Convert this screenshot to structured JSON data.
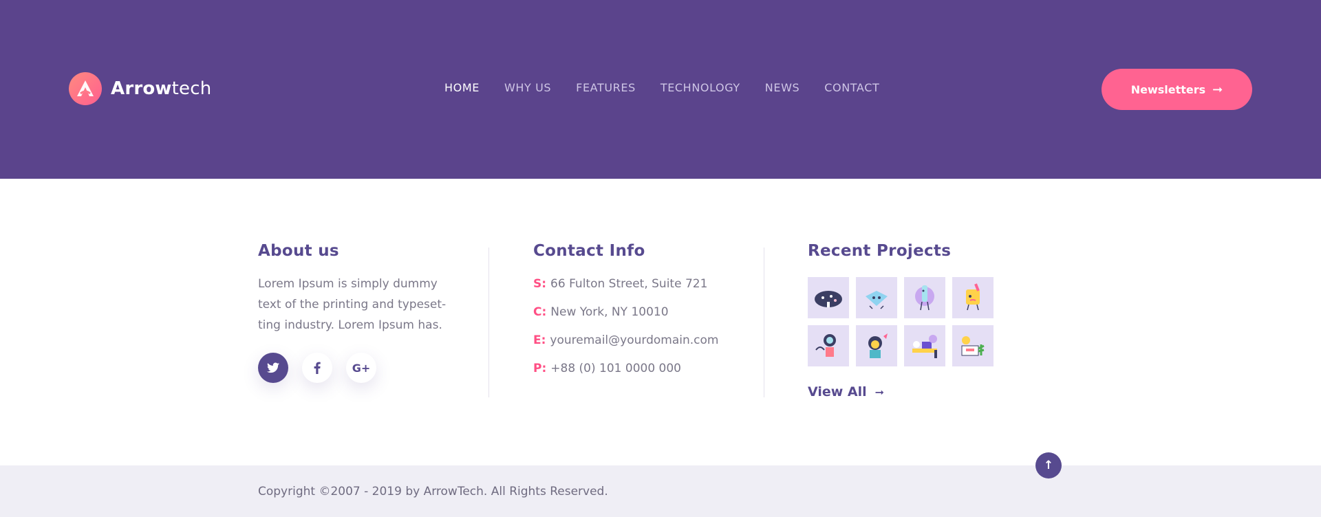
{
  "brand": {
    "name_bold": "Arrow",
    "name_light": "tech",
    "icon": "arrow-logo-icon"
  },
  "nav": {
    "items": [
      {
        "label": "HOME",
        "active": true
      },
      {
        "label": "WHY US"
      },
      {
        "label": "FEATURES"
      },
      {
        "label": "TECHNOLOGY"
      },
      {
        "label": "NEWS"
      },
      {
        "label": "CONTACT"
      }
    ]
  },
  "header": {
    "newsletter_label": "Newsletters",
    "arrow": "➞"
  },
  "about": {
    "title": "About us",
    "text": "Lorem Ipsum is simply dummy text of the printing and typeset-ting industry. Lorem Ipsum has.",
    "social": [
      {
        "icon": "twitter-icon"
      },
      {
        "icon": "facebook-icon"
      },
      {
        "icon": "google-plus-icon",
        "glyph": "G+"
      }
    ]
  },
  "contact": {
    "title": "Contact Info",
    "rows": [
      {
        "key": "S:",
        "value": "66 Fulton Street, Suite 721"
      },
      {
        "key": "C:",
        "value": "New York, NY 10010"
      },
      {
        "key": "E:",
        "value": "youremail@yourdomain.com"
      },
      {
        "key": "P:",
        "value": "+88 (0) 101 0000 000"
      }
    ]
  },
  "projects": {
    "title": "Recent Projects",
    "thumbnails": [
      "project-thumb-1",
      "project-thumb-2",
      "project-thumb-3",
      "project-thumb-4",
      "project-thumb-5",
      "project-thumb-6",
      "project-thumb-7",
      "project-thumb-8"
    ],
    "view_all": "View All",
    "arrow": "➞"
  },
  "footer": {
    "copyright": "Copyright ©2007 - 2019 by ArrowTech. All Rights Reserved."
  },
  "back_to_top": {
    "icon": "arrow-up-icon",
    "glyph": "↑"
  },
  "colors": {
    "header_bg": "#5b448c",
    "accent": "#ff6391",
    "heading": "#574a8f",
    "bottom_bg": "#efeef5"
  }
}
